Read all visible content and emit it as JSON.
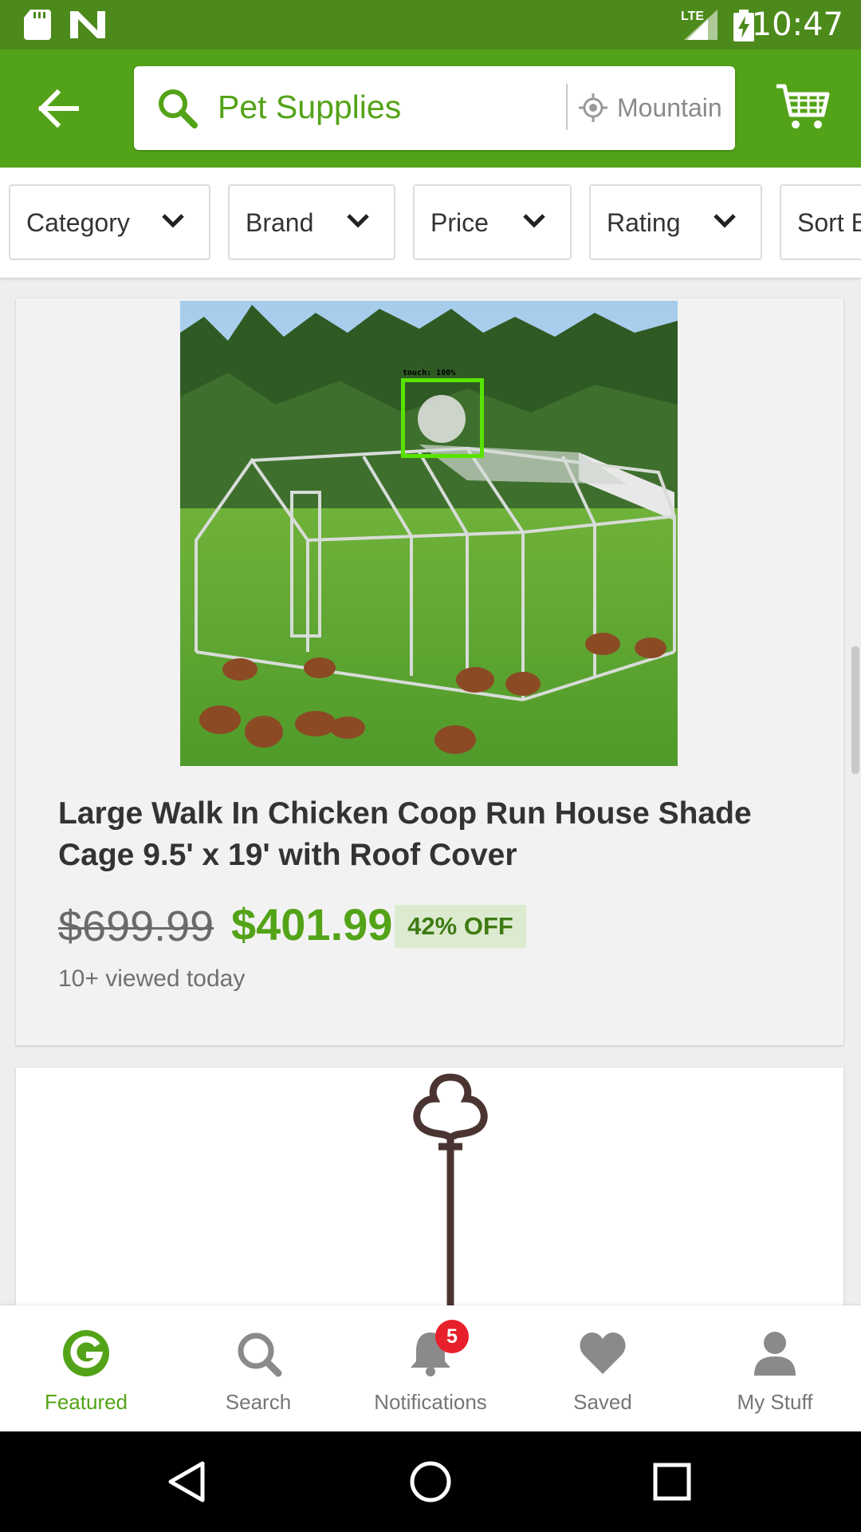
{
  "status_bar": {
    "time": "10:47",
    "network": "LTE",
    "icons": [
      "sd-card-icon",
      "n-notification-icon",
      "signal-icon",
      "battery-charging-icon"
    ]
  },
  "header": {
    "search_query": "Pet Supplies",
    "location": "Mountain View",
    "icons": [
      "back-arrow-icon",
      "search-icon",
      "location-icon",
      "cart-icon"
    ]
  },
  "filters": [
    {
      "label": "Category"
    },
    {
      "label": "Brand"
    },
    {
      "label": "Price"
    },
    {
      "label": "Rating"
    },
    {
      "label": "Sort By"
    }
  ],
  "product": {
    "title": "Large Walk In Chicken Coop Run House Shade Cage 9.5' x 19' with Roof Cover",
    "original_price": "$699.99",
    "sale_price": "$401.99",
    "discount": "42% OFF",
    "views": "10+ viewed today",
    "touch_label": "touch: 100%"
  },
  "bottom_nav": {
    "items": [
      {
        "label": "Featured",
        "icon": "groupon-g-icon",
        "active": true
      },
      {
        "label": "Search",
        "icon": "search-icon",
        "active": false
      },
      {
        "label": "Notifications",
        "icon": "bell-icon",
        "active": false
      },
      {
        "label": "Saved",
        "icon": "heart-icon",
        "active": false
      },
      {
        "label": "My Stuff",
        "icon": "person-icon",
        "active": false
      }
    ],
    "notification_count": "5"
  },
  "colors": {
    "brand_green": "#53a318",
    "status_green": "#4c8a1b",
    "badge_red": "#e8202b"
  }
}
